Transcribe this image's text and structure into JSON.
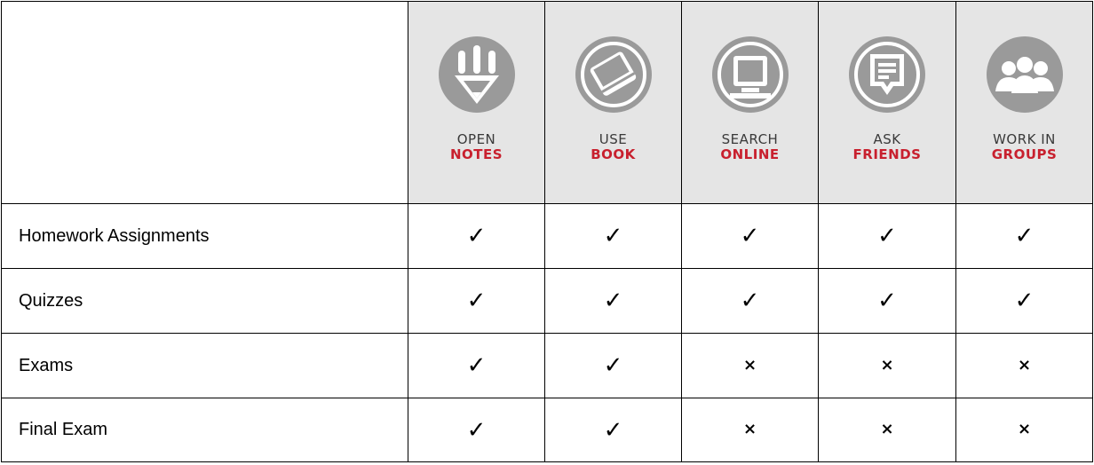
{
  "columns": [
    {
      "icon": "pencil-icon",
      "line1": "OPEN",
      "line2": "NOTES"
    },
    {
      "icon": "book-icon",
      "line1": "USE",
      "line2": "BOOK"
    },
    {
      "icon": "computer-icon",
      "line1": "SEARCH",
      "line2": "ONLINE"
    },
    {
      "icon": "chat-bubble-icon",
      "line1": "ASK",
      "line2": "FRIENDS"
    },
    {
      "icon": "group-icon",
      "line1": "WORK IN",
      "line2": "GROUPS"
    }
  ],
  "rows": [
    {
      "label": "Homework Assignments",
      "marks": [
        "✓",
        "✓",
        "✓",
        "✓",
        "✓"
      ]
    },
    {
      "label": "Quizzes",
      "marks": [
        "✓",
        "✓",
        "✓",
        "✓",
        "✓"
      ]
    },
    {
      "label": "Exams",
      "marks": [
        "✓",
        "✓",
        "×",
        "×",
        "×"
      ]
    },
    {
      "label": "Final Exam",
      "marks": [
        "✓",
        "✓",
        "×",
        "×",
        "×"
      ]
    }
  ],
  "colors": {
    "icon_gray": "#9a9a9a",
    "header_bg": "#e5e5e5",
    "accent_red": "#c8202e"
  }
}
